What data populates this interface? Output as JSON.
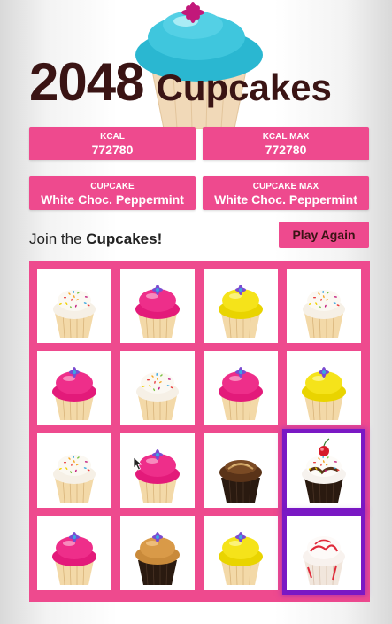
{
  "title": {
    "number": "2048",
    "word": "Cupcakes"
  },
  "stats": [
    {
      "label": "KCAL",
      "value": "772780"
    },
    {
      "label": "KCAL MAX",
      "value": "772780"
    },
    {
      "label": "CUPCAKE",
      "value": "White Choc. Peppermint"
    },
    {
      "label": "CUPCAKE MAX",
      "value": "White Choc. Peppermint"
    }
  ],
  "tagline": {
    "prefix": "Join the ",
    "strong": "Cupcakes!"
  },
  "play_again_label": "Play Again",
  "colors": {
    "accent_pink": "#ee4a8e",
    "title_brown": "#3a1414",
    "highlight_purple": "#7a18c4"
  },
  "board": [
    [
      "vanilla-sprinkles",
      "pink-frosted",
      "yellow-frosted",
      "vanilla-sprinkles"
    ],
    [
      "pink-frosted",
      "vanilla-sprinkles",
      "pink-frosted",
      "yellow-frosted"
    ],
    [
      "vanilla-sprinkles",
      "pink-frosted",
      "chocolate-swirl",
      "white-choc-cherry"
    ],
    [
      "pink-frosted",
      "caramel-chocolate",
      "yellow-frosted",
      "white-choc-peppermint"
    ]
  ],
  "highlighted_tiles": [
    "white-choc-cherry",
    "white-choc-peppermint"
  ]
}
